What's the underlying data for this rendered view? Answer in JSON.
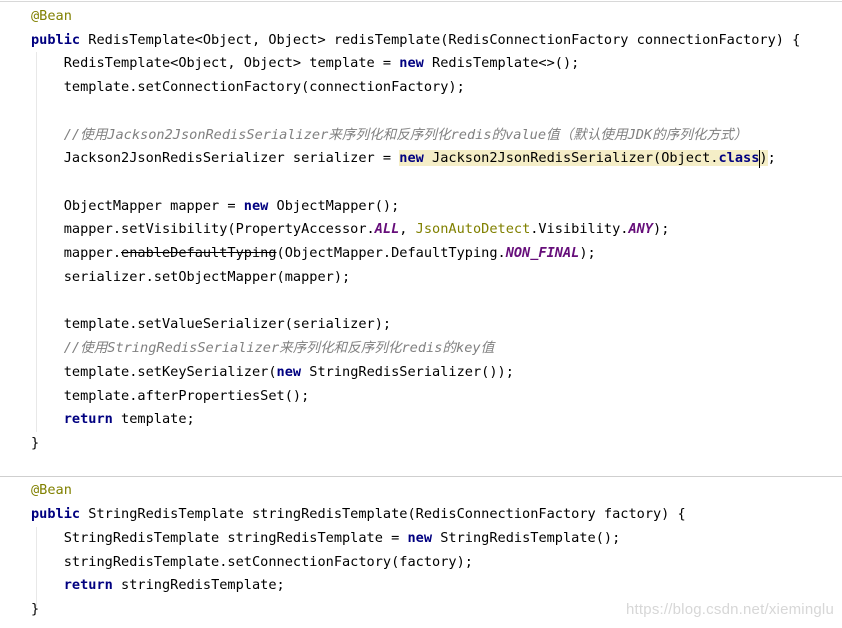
{
  "editor": {
    "lines": [
      {
        "tokens": [
          {
            "t": "@Bean",
            "s": "annotation"
          }
        ]
      },
      {
        "tokens": [
          {
            "t": "public",
            "s": "kw"
          },
          {
            "t": " RedisTemplate<Object, Object> redisTemplate(RedisConnectionFactory connectionFactory) {"
          }
        ]
      },
      {
        "tokens": [
          {
            "t": "    RedisTemplate<Object, Object> template = "
          },
          {
            "t": "new",
            "s": "kw"
          },
          {
            "t": " RedisTemplate<>();"
          }
        ]
      },
      {
        "tokens": [
          {
            "t": "    template.setConnectionFactory(connectionFactory);"
          }
        ]
      },
      {
        "tokens": []
      },
      {
        "tokens": [
          {
            "t": "    //使用Jackson2JsonRedisSerializer来序列化和反序列化redis的value值（默认使用JDK的序列化方式）",
            "s": "comment"
          }
        ]
      },
      {
        "tokens": [
          {
            "t": "    Jackson2JsonRedisSerializer serializer = "
          },
          {
            "t": "new",
            "s": "kw hl"
          },
          {
            "t": " Jackson2JsonRedisSerializer(Object.",
            "s": "hl"
          },
          {
            "t": "class",
            "s": "kw hl"
          },
          {
            "t": ")",
            "s": "hl"
          },
          {
            "t": ";"
          }
        ]
      },
      {
        "tokens": []
      },
      {
        "tokens": [
          {
            "t": "    ObjectMapper mapper = "
          },
          {
            "t": "new",
            "s": "kw"
          },
          {
            "t": " ObjectMapper();"
          }
        ]
      },
      {
        "tokens": [
          {
            "t": "    mapper.setVisibility(PropertyAccessor."
          },
          {
            "t": "ALL",
            "s": "static-field"
          },
          {
            "t": ", "
          },
          {
            "t": "JsonAutoDetect",
            "s": "class-ref"
          },
          {
            "t": ".Visibility."
          },
          {
            "t": "ANY",
            "s": "static-field"
          },
          {
            "t": ");"
          }
        ]
      },
      {
        "tokens": [
          {
            "t": "    mapper."
          },
          {
            "t": "enableDefaultTyping",
            "s": "strike"
          },
          {
            "t": "(ObjectMapper.DefaultTyping."
          },
          {
            "t": "NON_FINAL",
            "s": "static-field"
          },
          {
            "t": ");"
          }
        ]
      },
      {
        "tokens": [
          {
            "t": "    serializer.setObjectMapper(mapper);"
          }
        ]
      },
      {
        "tokens": []
      },
      {
        "tokens": [
          {
            "t": "    template.setValueSerializer(serializer);"
          }
        ]
      },
      {
        "tokens": [
          {
            "t": "    //使用StringRedisSerializer来序列化和反序列化redis的key值",
            "s": "comment"
          }
        ]
      },
      {
        "tokens": [
          {
            "t": "    template.setKeySerializer("
          },
          {
            "t": "new",
            "s": "kw"
          },
          {
            "t": " StringRedisSerializer());"
          }
        ]
      },
      {
        "tokens": [
          {
            "t": "    template.afterPropertiesSet();"
          }
        ]
      },
      {
        "tokens": [
          {
            "t": "    "
          },
          {
            "t": "return",
            "s": "kw"
          },
          {
            "t": " template;"
          }
        ]
      },
      {
        "tokens": [
          {
            "t": "}"
          }
        ]
      },
      {
        "tokens": []
      },
      {
        "tokens": [
          {
            "t": "@Bean",
            "s": "annotation"
          }
        ]
      },
      {
        "tokens": [
          {
            "t": "public",
            "s": "kw"
          },
          {
            "t": " StringRedisTemplate stringRedisTemplate(RedisConnectionFactory factory) {"
          }
        ]
      },
      {
        "tokens": [
          {
            "t": "    StringRedisTemplate stringRedisTemplate = "
          },
          {
            "t": "new",
            "s": "kw"
          },
          {
            "t": " StringRedisTemplate();"
          }
        ]
      },
      {
        "tokens": [
          {
            "t": "    stringRedisTemplate.setConnectionFactory(factory);"
          }
        ]
      },
      {
        "tokens": [
          {
            "t": "    "
          },
          {
            "t": "return",
            "s": "kw"
          },
          {
            "t": " stringRedisTemplate;"
          }
        ]
      },
      {
        "tokens": [
          {
            "t": "}"
          }
        ]
      }
    ]
  },
  "watermark": "https://blog.csdn.net/xieminglu",
  "colors": {
    "keyword": "#000080",
    "annotation": "#808000",
    "comment": "#808080",
    "static_field": "#660e7a",
    "highlight": "#f5eec7"
  }
}
